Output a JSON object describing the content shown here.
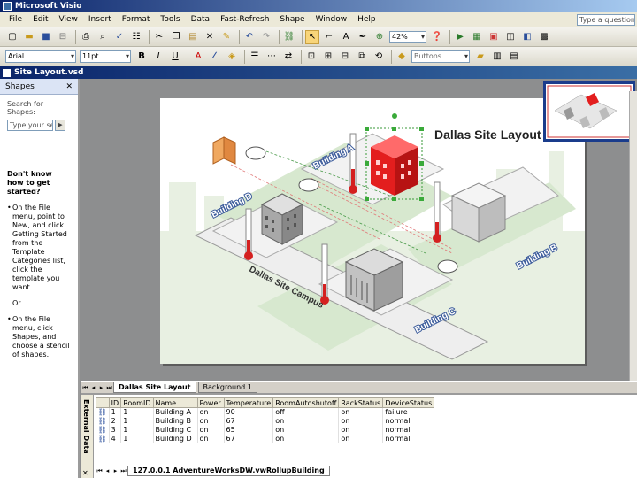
{
  "app": {
    "title": "Microsoft Visio"
  },
  "menu": [
    "File",
    "Edit",
    "View",
    "Insert",
    "Format",
    "Tools",
    "Data",
    "Fast-Refresh",
    "Shape",
    "Window",
    "Help"
  ],
  "help_placeholder": "Type a question for help",
  "toolbar": {
    "zoom": "42%",
    "font": "Arial",
    "font_size": "11pt",
    "hint_text": "Buttons"
  },
  "document": {
    "title": "Site Layout.vsd"
  },
  "shapes_pane": {
    "title": "Shapes",
    "search_label": "Search for Shapes:",
    "search_placeholder": "Type your search here",
    "help_heading": "Don't know how to get started?",
    "help_item_1": "On the File menu, point to New, and click Getting Started from the Template Categories list, click the template you want.",
    "or_text": "Or",
    "help_item_2": "On the File menu, click Shapes, and choose a stencil of shapes."
  },
  "diagram": {
    "title": "Dallas Site Layout",
    "labels": {
      "building_a": "Building A",
      "building_b": "Building B",
      "building_c": "Building C",
      "building_d": "Building D",
      "campus": "Dallas Site Campus"
    }
  },
  "page_tabs": [
    "Dallas Site Layout",
    "Background 1"
  ],
  "external_data": {
    "pane_label": "External Data",
    "columns": [
      "",
      "ID",
      "RoomID",
      "Name",
      "Power",
      "Temperature",
      "RoomAutoshutoff",
      "RackStatus",
      "DeviceStatus"
    ],
    "rows": [
      [
        "1",
        "1",
        "Building A",
        "on",
        "90",
        "off",
        "on",
        "failure"
      ],
      [
        "2",
        "1",
        "Building B",
        "on",
        "67",
        "on",
        "on",
        "normal"
      ],
      [
        "3",
        "1",
        "Building C",
        "on",
        "65",
        "on",
        "on",
        "normal"
      ],
      [
        "4",
        "1",
        "Building D",
        "on",
        "67",
        "on",
        "on",
        "normal"
      ]
    ],
    "source_tab": "127.0.0.1 AdventureWorksDW.vwRollupBuilding"
  },
  "colors": {
    "title_bar": "#0a246a",
    "hot_building": "#e31e1e",
    "green_zone": "#cfe3c8",
    "gray_zone": "#e6e6e6"
  }
}
